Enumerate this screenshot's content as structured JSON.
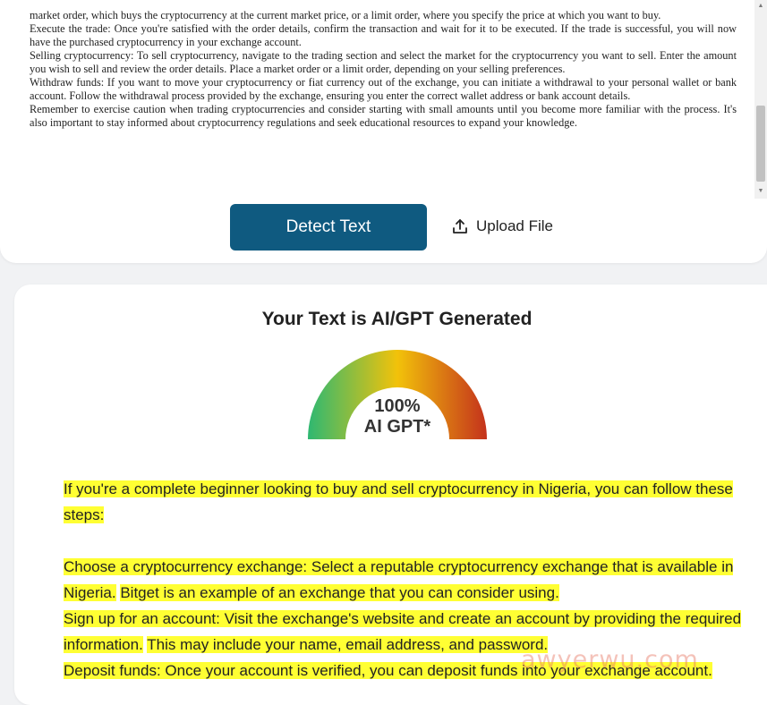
{
  "input_text": {
    "paragraphs": [
      "market order, which buys the cryptocurrency at the current market price, or a limit order, where you specify the price at which you want to buy.",
      "Execute the trade: Once you're satisfied with the order details, confirm the transaction and wait for it to be executed. If the trade is successful, you will now have the purchased cryptocurrency in your exchange account.",
      "Selling cryptocurrency: To sell cryptocurrency, navigate to the trading section and select the market for the cryptocurrency you want to sell. Enter the amount you wish to sell and review the order details. Place a market order or a limit order, depending on your selling preferences.",
      "Withdraw funds: If you want to move your cryptocurrency or fiat currency out of the exchange, you can initiate a withdrawal to your personal wallet or bank account. Follow the withdrawal process provided by the exchange, ensuring you enter the correct wallet address or bank account details.",
      "Remember to exercise caution when trading cryptocurrencies and consider starting with small amounts until you become more familiar with the process. It's also important to stay informed about cryptocurrency regulations and seek educational resources to expand your knowledge."
    ]
  },
  "actions": {
    "detect_label": "Detect Text",
    "upload_label": "Upload File"
  },
  "result": {
    "title": "Your Text is AI/GPT Generated",
    "gauge_percent": 100,
    "gauge_value": "100%",
    "gauge_label": "AI GPT*",
    "gauge_colors": [
      "#2eb872",
      "#f2c20a",
      "#c4321c"
    ]
  },
  "highlighted": {
    "p1": "If you're a complete beginner looking to buy and sell cryptocurrency in Nigeria, you can follow these steps:",
    "p2a": "Choose a cryptocurrency exchange: Select a reputable cryptocurrency exchange that is available in Nigeria.",
    "p2b": "Bitget is an example of an exchange that you can consider using.",
    "p3a": "Sign up for an account: Visit the exchange's website and create an account by providing the required information.",
    "p3b": "This may include your name, email address, and password.",
    "p4": "Deposit funds: Once your account is verified, you can deposit funds into your exchange account."
  },
  "watermark": "awyerwu.com",
  "colors": {
    "button": "#0f5a80",
    "highlight": "#ffff33"
  }
}
